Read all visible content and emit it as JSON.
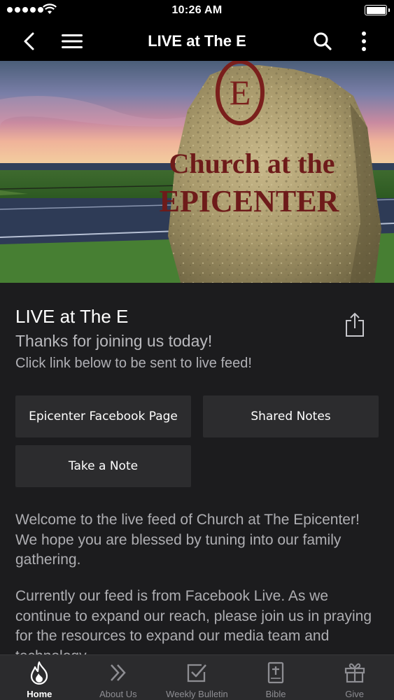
{
  "status_bar": {
    "time": "10:26 AM"
  },
  "nav": {
    "title": "LIVE at The E",
    "icons": [
      "back-icon",
      "menu-icon",
      "search-icon",
      "more-icon"
    ]
  },
  "hero": {
    "sign_top": "Church at the",
    "sign_bottom": "EPICENTER",
    "emblem_letter": "E"
  },
  "content": {
    "title": "LIVE at The E",
    "subtitle": "Thanks for joining us today!",
    "instruction": "Click link below to be sent to live feed!",
    "buttons": {
      "facebook": "Epicenter Facebook Page",
      "shared_notes": "Shared Notes",
      "take_note": "Take a Note"
    },
    "paragraph1": "Welcome to the live feed of Church at The Epicenter! We hope you are blessed by tuning into our family gathering.",
    "paragraph2": "Currently our feed is from Facebook Live. As we continue to expand our reach, please join us in praying for the resources to expand our media team and technology."
  },
  "tabbar": {
    "tabs": [
      {
        "label": "Home",
        "icon": "flame-icon",
        "active": true
      },
      {
        "label": "About Us",
        "icon": "double-chevron-icon",
        "active": false
      },
      {
        "label": "Weekly Bulletin",
        "icon": "checkbox-icon",
        "active": false
      },
      {
        "label": "Bible",
        "icon": "bible-icon",
        "active": false
      },
      {
        "label": "Give",
        "icon": "gift-icon",
        "active": false
      }
    ]
  },
  "colors": {
    "background": "#1c1c1e",
    "button": "#2c2c2e",
    "tabbar": "#2b2b2d",
    "navbar": "#000000"
  }
}
